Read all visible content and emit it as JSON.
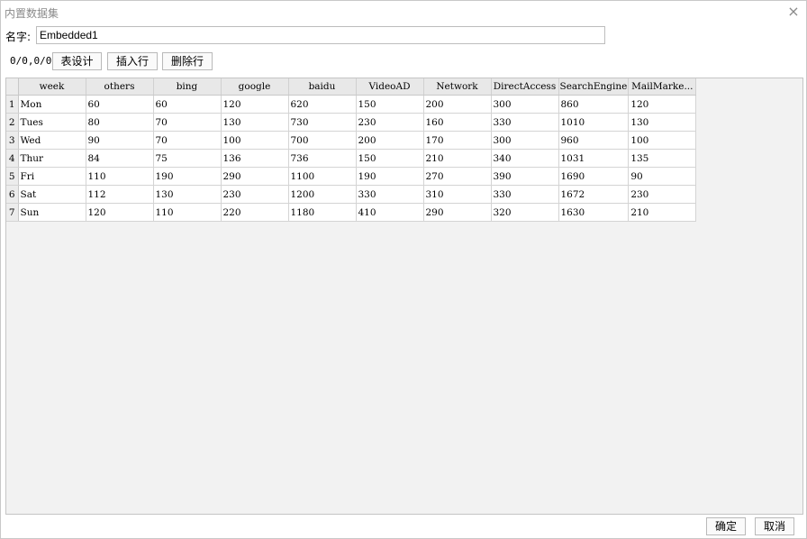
{
  "window": {
    "title": "内置数据集",
    "close_glyph": "×"
  },
  "name_field": {
    "label": "名字:",
    "value": "Embedded1"
  },
  "toolbar": {
    "counter": "0/0,0/0",
    "table_design": "表设计",
    "insert_row": "插入行",
    "delete_row": "删除行"
  },
  "table": {
    "columns": [
      "week",
      "others",
      "bing",
      "google",
      "baidu",
      "VideoAD",
      "Network",
      "DirectAccess",
      "SearchEngine",
      "MailMarke..."
    ],
    "rows": [
      {
        "num": "1",
        "cells": [
          "Mon",
          "60",
          "60",
          "120",
          "620",
          "150",
          "200",
          "300",
          "860",
          "120"
        ]
      },
      {
        "num": "2",
        "cells": [
          "Tues",
          "80",
          "70",
          "130",
          "730",
          "230",
          "160",
          "330",
          "1010",
          "130"
        ]
      },
      {
        "num": "3",
        "cells": [
          "Wed",
          "90",
          "70",
          "100",
          "700",
          "200",
          "170",
          "300",
          "960",
          "100"
        ]
      },
      {
        "num": "4",
        "cells": [
          "Thur",
          "84",
          "75",
          "136",
          "736",
          "150",
          "210",
          "340",
          "1031",
          "135"
        ]
      },
      {
        "num": "5",
        "cells": [
          "Fri",
          "110",
          "190",
          "290",
          "1100",
          "190",
          "270",
          "390",
          "1690",
          "90"
        ]
      },
      {
        "num": "6",
        "cells": [
          "Sat",
          "112",
          "130",
          "230",
          "1200",
          "330",
          "310",
          "330",
          "1672",
          "230"
        ]
      },
      {
        "num": "7",
        "cells": [
          "Sun",
          "120",
          "110",
          "220",
          "1180",
          "410",
          "290",
          "320",
          "1630",
          "210"
        ]
      }
    ]
  },
  "footer": {
    "ok": "确定",
    "cancel": "取消"
  }
}
